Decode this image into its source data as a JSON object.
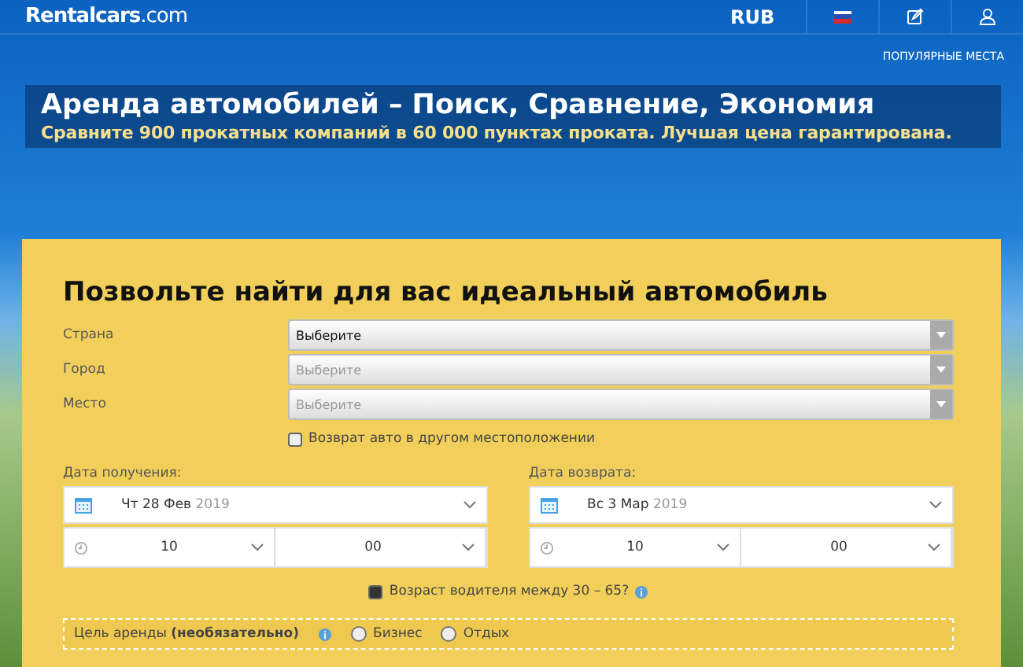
{
  "header": {
    "logo": "**Rentalcars**.com",
    "currency": "RUB"
  },
  "nav_link": "ПОПУЛЯРНЫЕ МЕСТА",
  "hero": {
    "title": "Аренда автомобилей – Поиск, Сравнение, Экономия",
    "subtitle": "Сравните 900 прокатных компаний в 60 000 пунктах проката. Лучшая цена гарантирована."
  },
  "form": {
    "title": "Позвольте найти для вас идеальный автомобиль",
    "selects": [
      {
        "label": "Страна",
        "value": "Выберите",
        "disabled": false
      },
      {
        "label": "Город",
        "value": "Выберите",
        "disabled": true
      },
      {
        "label": "Место",
        "value": "Выберите",
        "disabled": true
      }
    ],
    "return_elsewhere": {
      "label": "Возврат авто в другом местоположении",
      "checked": false
    },
    "dates": [
      {
        "label": "Дата получения:",
        "date": "Чт 28 Фев",
        "year": "2019",
        "hour": "10",
        "minute": "00"
      },
      {
        "label": "Дата возврата:",
        "date": "Вс 3 Мар",
        "year": "2019",
        "hour": "10",
        "minute": "00"
      }
    ],
    "age": {
      "label": "Возраст водителя между 30 – 65?",
      "checked": true
    },
    "purpose": {
      "label": "Цель аренды **(необязательно)**",
      "options": [
        {
          "label": "Бизнес",
          "selected": false
        },
        {
          "label": "Отдых",
          "selected": false
        }
      ]
    }
  }
}
